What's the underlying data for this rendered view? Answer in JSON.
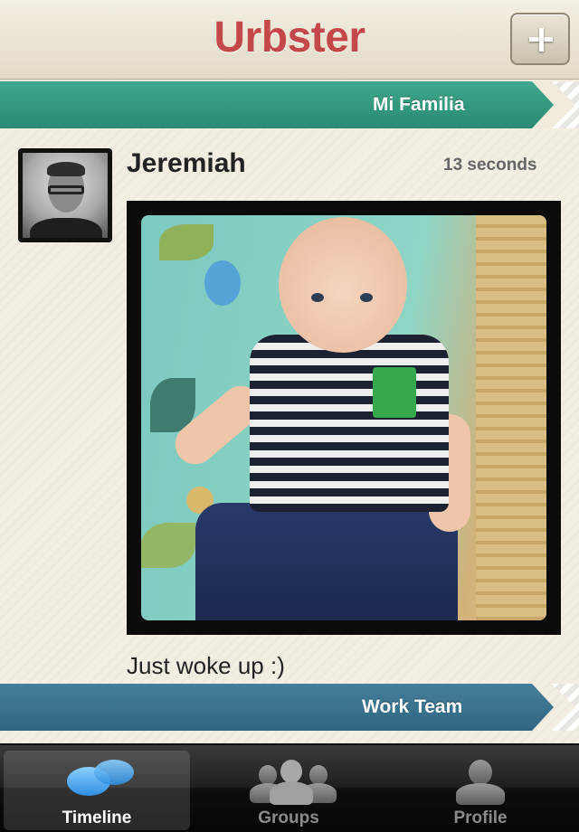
{
  "header": {
    "title": "Urbster",
    "add_icon": "plus-icon"
  },
  "groups": [
    {
      "name": "Mi Familia",
      "color": "#2f9a7e"
    },
    {
      "name": "Work Team",
      "color": "#3a7390"
    }
  ],
  "post": {
    "author": "Jeremiah",
    "time": "13 seconds",
    "caption": "Just woke up :)"
  },
  "tabbar": {
    "tabs": [
      {
        "label": "Timeline",
        "icon": "chat-bubbles-icon",
        "active": true
      },
      {
        "label": "Groups",
        "icon": "group-people-icon",
        "active": false
      },
      {
        "label": "Profile",
        "icon": "person-icon",
        "active": false
      }
    ]
  }
}
